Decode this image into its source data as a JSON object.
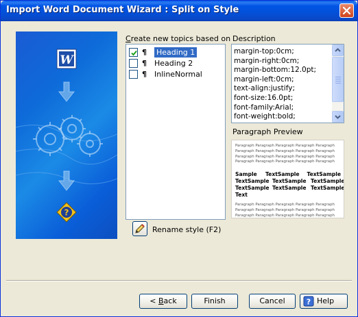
{
  "window": {
    "title": "Import Word Document Wizard : Split on Style"
  },
  "topics": {
    "label_prefix": "C",
    "label_rest": "reate new topics based on",
    "items": [
      {
        "label": "Heading 1",
        "checked": true,
        "selected": true
      },
      {
        "label": "Heading 2",
        "checked": false,
        "selected": false
      },
      {
        "label": "InlineNormal",
        "checked": false,
        "selected": false
      }
    ],
    "pilcrow": "¶"
  },
  "description": {
    "label": "Description",
    "lines": [
      "margin-top:0cm;",
      "margin-right:0cm;",
      "margin-bottom:12.0pt;",
      "margin-left:0cm;",
      "text-align:justify;",
      "font-size:16.0pt;",
      "font-family:Arial;",
      "font-weight:bold;"
    ]
  },
  "preview": {
    "label": "Paragraph Preview",
    "filler_before": "Paragraph Paragraph Paragraph Paragraph Paragraph Paragraph Paragraph Paragraph Paragraph Paragraph Paragraph Paragraph Paragraph Paragraph Paragraph Paragraph Paragraph Paragraph Paragraph Paragraph",
    "sample_line_1": [
      "Sample",
      "TextSample",
      "TextSample"
    ],
    "sample_line_2": [
      "TextSample",
      "TextSample",
      "TextSample"
    ],
    "sample_line_3": [
      "TextSample",
      "TextSample",
      "TextSample"
    ],
    "sample_line_4": [
      "Text"
    ],
    "filler_after": "Paragraph Paragraph Paragraph Paragraph Paragraph Paragraph Paragraph Paragraph Paragraph Paragraph Paragraph Paragraph Paragraph Paragraph Paragraph Paragraph Paragraph Paragraph Paragraph Paragraph Paragraph Paragraph Paragraph Paragraph Paragraph Paragraph"
  },
  "rename": {
    "label": "Rename style (F2)"
  },
  "buttons": {
    "back_prefix": "< ",
    "back_key": "B",
    "back_rest": "ack",
    "finish": "Finish",
    "cancel": "Cancel",
    "help": "Help"
  },
  "colors": {
    "titlebar": "#0055e5",
    "selection": "#316ac5",
    "panel_blue": "#1b8ae6"
  },
  "icons": {
    "word": "word-document-icon",
    "arrow": "down-arrow-icon",
    "gears": "gears-icon",
    "help": "question-icon",
    "pencil": "pencil-icon",
    "close": "close-icon"
  }
}
